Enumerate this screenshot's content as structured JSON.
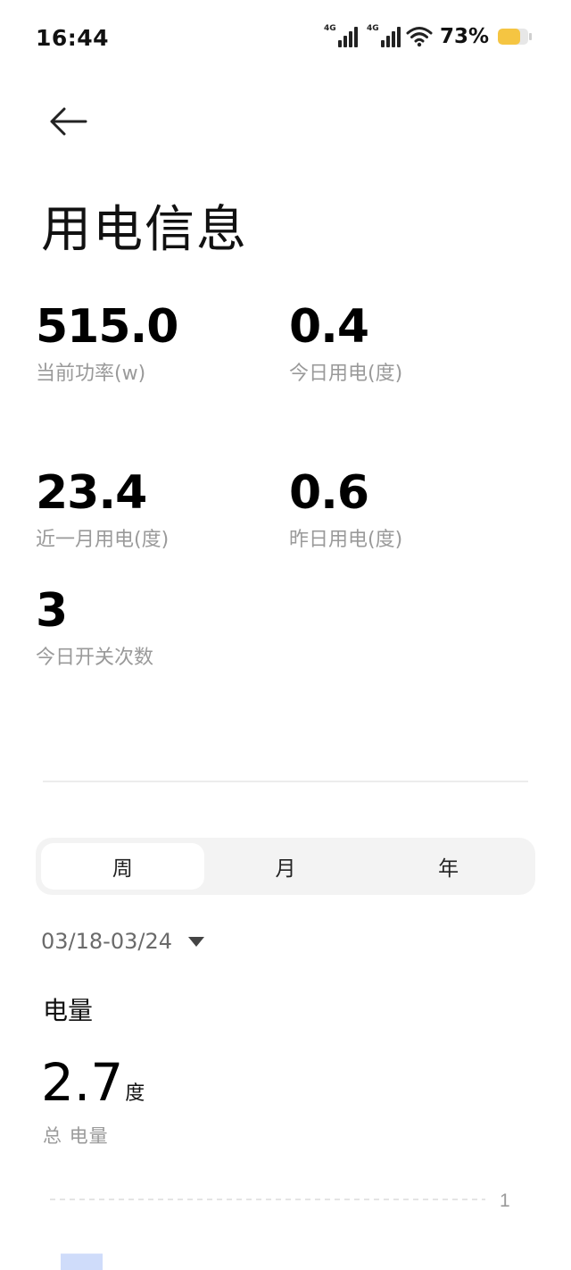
{
  "status_bar": {
    "time": "16:44",
    "sim1_tag": "4G",
    "sim2_tag": "4G",
    "battery_percent": "73%",
    "battery_level": 0.73,
    "battery_color": "#f5c542"
  },
  "header": {
    "back_icon": "arrow-left-icon",
    "title": "用电信息"
  },
  "stats": [
    {
      "value": "515.0",
      "label": "当前功率(w)"
    },
    {
      "value": "0.4",
      "label": "今日用电(度)"
    },
    {
      "value": "23.4",
      "label": "近一月用电(度)"
    },
    {
      "value": "0.6",
      "label": "昨日用电(度)"
    },
    {
      "value": "3",
      "label": "今日开关次数"
    }
  ],
  "period_tabs": {
    "items": [
      {
        "label": "周",
        "active": true
      },
      {
        "label": "月",
        "active": false
      },
      {
        "label": "年",
        "active": false
      }
    ]
  },
  "date_range": {
    "text": "03/18-03/24",
    "icon": "caret-down-icon"
  },
  "energy": {
    "section_title": "电量",
    "total_value": "2.7",
    "total_unit": "度",
    "total_label": "总 电量"
  },
  "chart_data": {
    "type": "bar",
    "y_tick_label": "1",
    "ylim": [
      0,
      1
    ],
    "values": [
      0.4
    ],
    "bar_color": "#cfdcfa",
    "grid": true
  }
}
